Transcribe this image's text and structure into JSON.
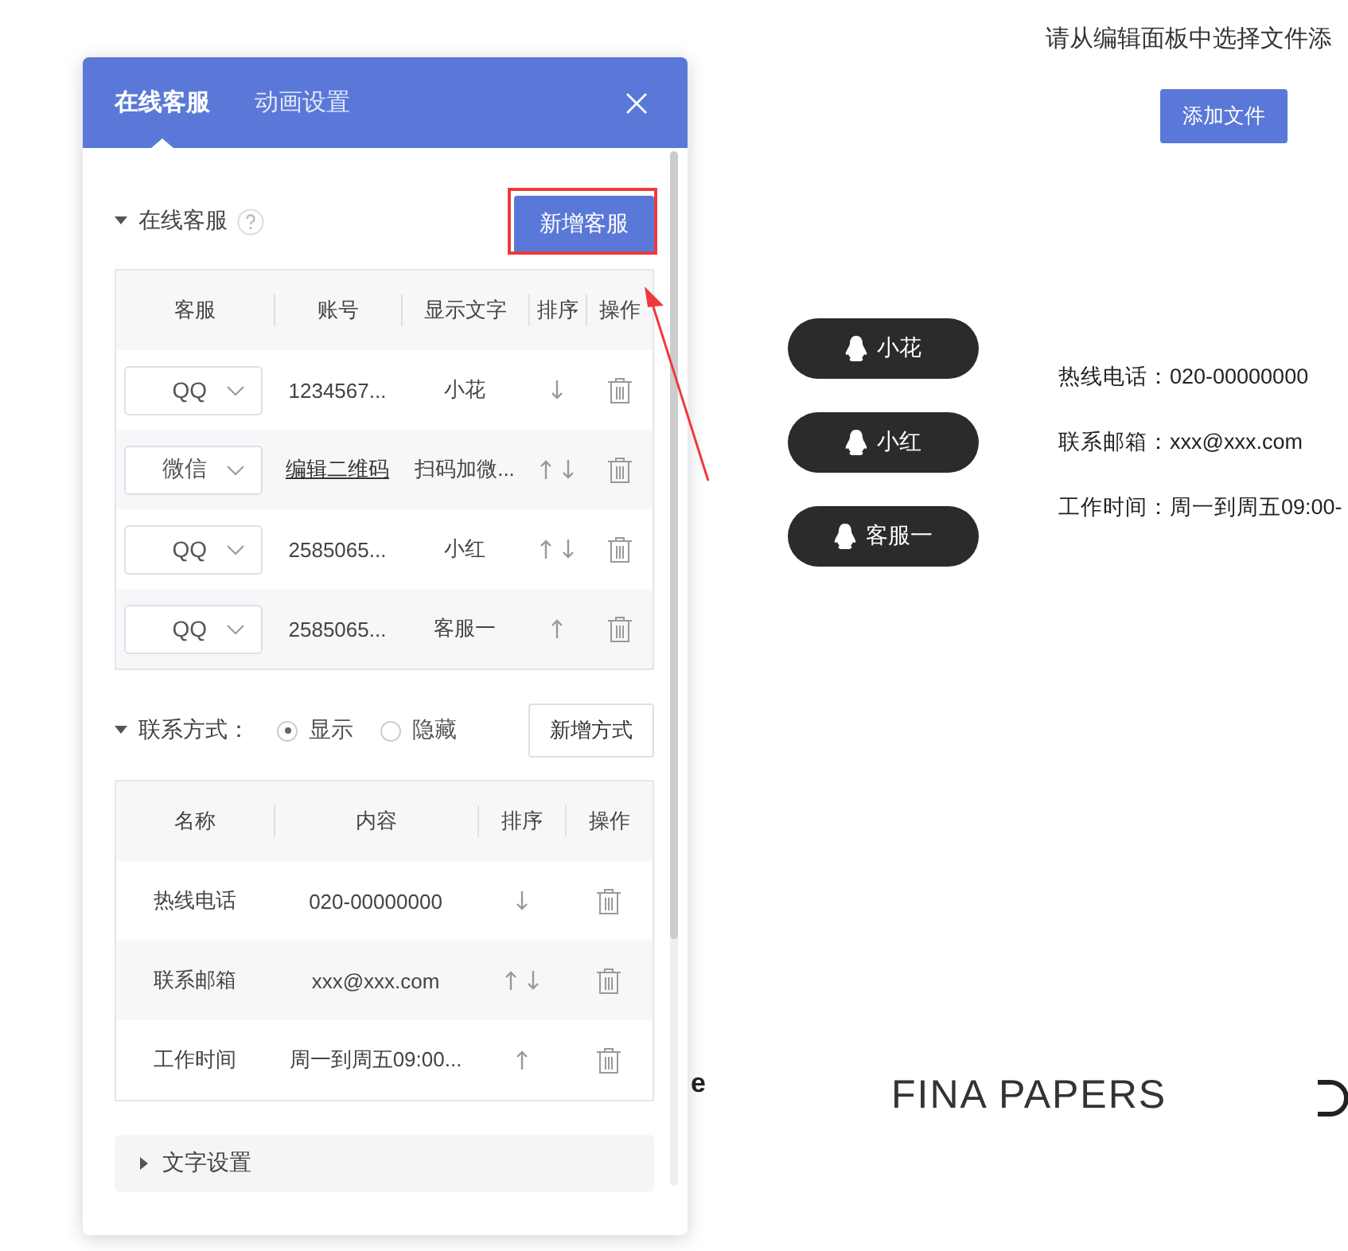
{
  "canvas": {
    "prompt": "请从编辑面板中选择文件添",
    "add_button": "添加文件",
    "service_buttons": [
      {
        "label": "小花"
      },
      {
        "label": "小红"
      },
      {
        "label": "客服一"
      }
    ],
    "contacts": [
      "热线电话：020-00000000",
      "联系邮箱：xxx@xxx.com",
      "工作时间：周一到周五09:00-"
    ],
    "fragment": "e",
    "logo": "FINA PAPERS"
  },
  "panel": {
    "tabs": [
      {
        "label": "在线客服",
        "selected": true
      },
      {
        "label": "动画设置",
        "selected": false
      }
    ],
    "service_section": {
      "title": "在线客服",
      "expanded": true,
      "add_button": "新增客服",
      "columns": [
        "客服",
        "账号",
        "显示文字",
        "排序",
        "操作"
      ],
      "rows": [
        {
          "type": "QQ",
          "account": "1234567...",
          "account_link": false,
          "display": "小花",
          "up": false,
          "down": true
        },
        {
          "type": "微信",
          "account": "编辑二维码",
          "account_link": true,
          "display": "扫码加微...",
          "up": true,
          "down": true
        },
        {
          "type": "QQ",
          "account": "2585065...",
          "account_link": false,
          "display": "小红",
          "up": true,
          "down": true
        },
        {
          "type": "QQ",
          "account": "2585065...",
          "account_link": false,
          "display": "客服一",
          "up": true,
          "down": false
        }
      ]
    },
    "contact_section": {
      "title": "联系方式：",
      "expanded": true,
      "options": [
        {
          "label": "显示",
          "selected": true
        },
        {
          "label": "隐藏",
          "selected": false
        }
      ],
      "add_button": "新增方式",
      "columns": [
        "名称",
        "内容",
        "排序",
        "操作"
      ],
      "rows": [
        {
          "name": "热线电话",
          "content": "020-00000000",
          "up": false,
          "down": true
        },
        {
          "name": "联系邮箱",
          "content": "xxx@xxx.com",
          "up": true,
          "down": true
        },
        {
          "name": "工作时间",
          "content": "周一到周五09:00...",
          "up": true,
          "down": false
        }
      ]
    },
    "text_section": {
      "title": "文字设置",
      "expanded": false
    }
  }
}
